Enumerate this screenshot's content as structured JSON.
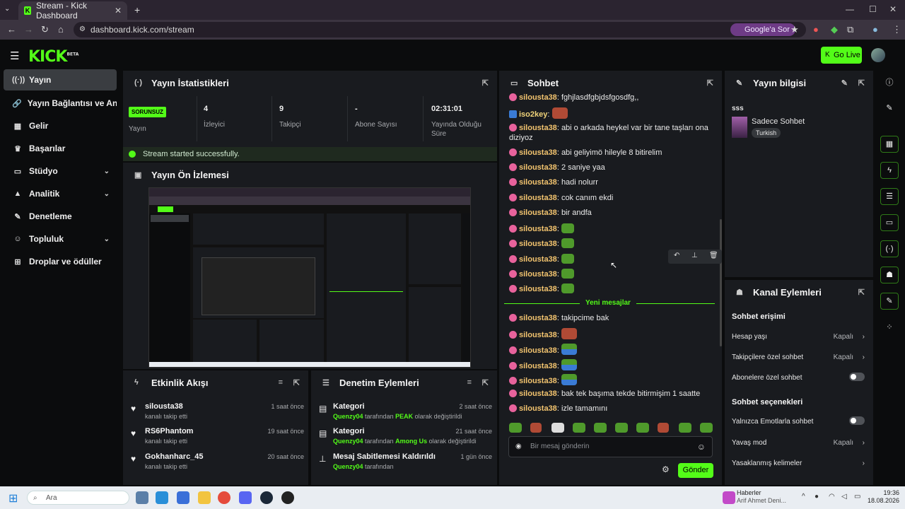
{
  "browser": {
    "tab_title": "Stream - Kick Dashboard",
    "url": "dashboard.kick.com/stream",
    "google_button": "Google'a Sor"
  },
  "header": {
    "logo": "KICK",
    "logo_badge": "BETA",
    "go_live": "Go Live"
  },
  "nav": {
    "items": [
      {
        "label": "Yayın",
        "icon": "broadcast-icon",
        "active": true
      },
      {
        "label": "Yayın Bağlantısı ve Anahtarı",
        "icon": "key-icon"
      },
      {
        "label": "Gelir",
        "icon": "revenue-icon"
      },
      {
        "label": "Başarılar",
        "icon": "trophy-icon"
      },
      {
        "label": "Stüdyo",
        "icon": "studio-icon",
        "expandable": true
      },
      {
        "label": "Analitik",
        "icon": "analytics-icon",
        "expandable": true
      },
      {
        "label": "Denetleme",
        "icon": "wrench-icon"
      },
      {
        "label": "Topluluk",
        "icon": "community-icon",
        "expandable": true
      },
      {
        "label": "Droplar ve ödüller",
        "icon": "gift-icon"
      }
    ]
  },
  "stats": {
    "title": "Yayın İstatistikleri",
    "status_badge": "SORUNSUZ",
    "status_label": "Yayın",
    "viewers": "4",
    "viewers_label": "İzleyici",
    "followers": "9",
    "followers_label": "Takipçi",
    "subs": "-",
    "subs_label": "Abone Sayısı",
    "uptime": "02:31:01",
    "uptime_label": "Yayında Olduğu Süre",
    "started_msg": "Stream started successfully."
  },
  "preview": {
    "title": "Yayın Ön İzlemesi"
  },
  "chat": {
    "title": "Sohbet",
    "new_messages": "Yeni mesajlar",
    "input_placeholder": "Bir mesaj gönderin",
    "send": "Gönder",
    "messages": [
      {
        "user": "silousta38",
        "text": "fghjlasdfgbjdsfgosdfg,,"
      },
      {
        "user": "iso2key",
        "text": "",
        "emote": "red"
      },
      {
        "user": "silousta38",
        "text": "abi o arkada heykel var bir tane taşları ona"
      },
      {
        "user": "",
        "text": "diziyoz"
      },
      {
        "user": "silousta38",
        "text": "abi geliyimö hileyle 8 bitirelim"
      },
      {
        "user": "silousta38",
        "text": "2 saniye yaa"
      },
      {
        "user": "silousta38",
        "text": "hadi nolurr"
      },
      {
        "user": "silousta38",
        "text": "cok canım ekdi"
      },
      {
        "user": "silousta38",
        "text": "bir andfa"
      },
      {
        "user": "silousta38",
        "text": "",
        "emote": "pepe"
      },
      {
        "user": "silousta38",
        "text": "",
        "emote": "pepe"
      },
      {
        "user": "silousta38",
        "text": "",
        "emote": "pepe"
      },
      {
        "user": "silousta38",
        "text": "",
        "emote": "pepe"
      },
      {
        "user": "silousta38",
        "text": "",
        "emote": "pepe"
      },
      {
        "user": "silousta38",
        "text": "takipcime bak"
      },
      {
        "user": "silousta38",
        "text": "",
        "emote": "red"
      },
      {
        "user": "silousta38",
        "text": "",
        "emote": "pepe2"
      },
      {
        "user": "silousta38",
        "text": "",
        "emote": "pepe2"
      },
      {
        "user": "silousta38",
        "text": "",
        "emote": "pepe2"
      },
      {
        "user": "silousta38",
        "text": "bak tek başıma tekde bitirmişim 1 saatte"
      },
      {
        "user": "silousta38",
        "text": "izle tamamını"
      }
    ]
  },
  "stream_info": {
    "title": "Yayın bilgisi",
    "stream_name": "sss",
    "category": "Sadece Sohbet",
    "language": "Turkish"
  },
  "channel_actions": {
    "title": "Kanal Eylemleri",
    "access_title": "Sohbet erişimi",
    "account_age": "Hesap yaşı",
    "account_age_val": "Kapalı",
    "followers_only": "Takipçilere özel sohbet",
    "followers_only_val": "Kapalı",
    "subs_only": "Abonelere özel sohbet",
    "options_title": "Sohbet seçenekleri",
    "emote_only": "Yalnızca Emotlarla sohbet",
    "slow_mode": "Yavaş mod",
    "slow_mode_val": "Kapalı",
    "banned_words": "Yasaklanmış kelimeler"
  },
  "activity": {
    "title": "Etkinlik Akışı",
    "items": [
      {
        "name": "silousta38",
        "sub": "kanalı takip etti",
        "time": "1 saat önce"
      },
      {
        "name": "RS6Phantom",
        "sub": "kanalı takip etti",
        "time": "19 saat önce"
      },
      {
        "name": "Gokhanharc_45",
        "sub": "kanalı takip etti",
        "time": "20 saat önce"
      }
    ]
  },
  "moderation": {
    "title": "Denetim Eylemleri",
    "items": [
      {
        "title": "Kategori",
        "user": "Quenzy04",
        "mid": "tarafından",
        "value": "PEAK",
        "end": "olarak değiştirildi",
        "time": "2 saat önce"
      },
      {
        "title": "Kategori",
        "user": "Quenzy04",
        "mid": "tarafından",
        "value": "Among Us",
        "end": "olarak değiştirildi",
        "time": "21 saat önce"
      },
      {
        "title": "Mesaj Sabitlemesi Kaldırıldı",
        "user": "Quenzy04",
        "mid": "tarafından",
        "value": "",
        "end": "",
        "time": "1 gün önce"
      }
    ]
  },
  "taskbar": {
    "search": "Ara",
    "news_title": "Haberler",
    "news_sub": "Arif Ahmet Deni...",
    "time": "19:36",
    "date": "18.08.2026"
  }
}
